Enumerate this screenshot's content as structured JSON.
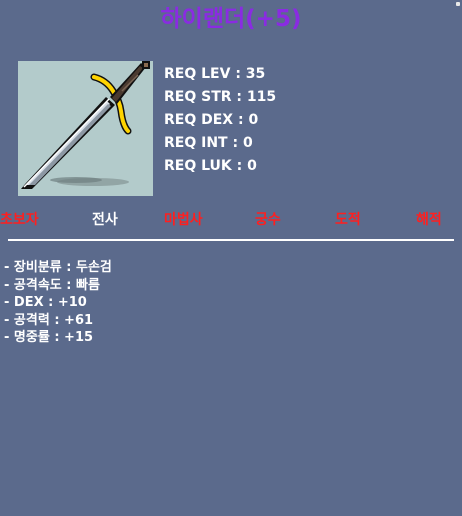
{
  "item": {
    "name": "하이랜더(+5)",
    "image_icon": "two-handed-sword-icon"
  },
  "requirements": [
    "REQ LEV : 35",
    "REQ STR : 115",
    "REQ DEX : 0",
    "REQ INT : 0",
    "REQ LUK : 0"
  ],
  "jobs": [
    {
      "label": "초보자",
      "allowed": false
    },
    {
      "label": "전사",
      "allowed": true
    },
    {
      "label": "마법사",
      "allowed": false
    },
    {
      "label": "궁수",
      "allowed": false
    },
    {
      "label": "도적",
      "allowed": false
    },
    {
      "label": "해적",
      "allowed": false
    }
  ],
  "stats": [
    "- 장비분류 : 두손검",
    "- 공격속도 : 빠름",
    "- DEX : +10",
    "- 공격력 : +61",
    "- 명중률 : +15"
  ],
  "colors": {
    "background": "#5b6a8c",
    "title": "#8a2be2",
    "job_disabled": "#ff1f1f",
    "job_allowed": "#ffffff",
    "image_bg": "#b3cbcb"
  }
}
